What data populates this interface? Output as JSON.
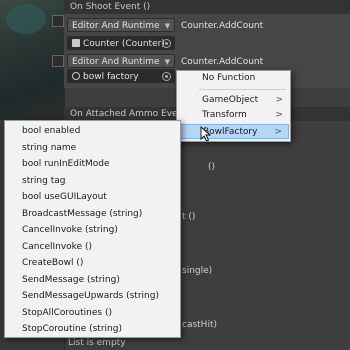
{
  "inspector": {
    "on_shoot_header": "On Shoot Event ()",
    "row1": {
      "mode": "Editor And Runtime",
      "object": "Counter (Counter)",
      "function": "Counter.AddCount"
    },
    "row2": {
      "mode": "Editor And Runtime",
      "object": "bowl factory",
      "function": "Counter.AddCount"
    },
    "on_attached_header": "On Attached Ammo Event",
    "partial_texts": [
      "()",
      "t ()",
      "single)",
      "castHit)"
    ],
    "list_empty": "List is empty"
  },
  "context_menu": {
    "items": [
      {
        "label": "No Function",
        "submenu": false
      },
      {
        "label": "GameObject",
        "submenu": true
      },
      {
        "label": "Transform",
        "submenu": true
      },
      {
        "label": "BowlFactory",
        "submenu": true,
        "highlighted": true
      }
    ],
    "submenu_glyph": ">"
  },
  "function_list": {
    "items": [
      "bool enabled",
      "string name",
      "bool runInEditMode",
      "string tag",
      "bool useGUILayout",
      "BroadcastMessage (string)",
      "CancelInvoke (string)",
      "CancelInvoke ()",
      "CreateBowl ()",
      "SendMessage (string)",
      "SendMessageUpwards (string)",
      "StopAllCoroutines ()",
      "StopCoroutine (string)"
    ]
  },
  "colors": {
    "editor_bg": "#3e3e3e",
    "menu_bg": "#f2f2f2",
    "menu_highlight": "#b5d7f7"
  },
  "icons": {
    "dropdown_arrow": "▼",
    "object_picker": "circle-dot-icon"
  }
}
